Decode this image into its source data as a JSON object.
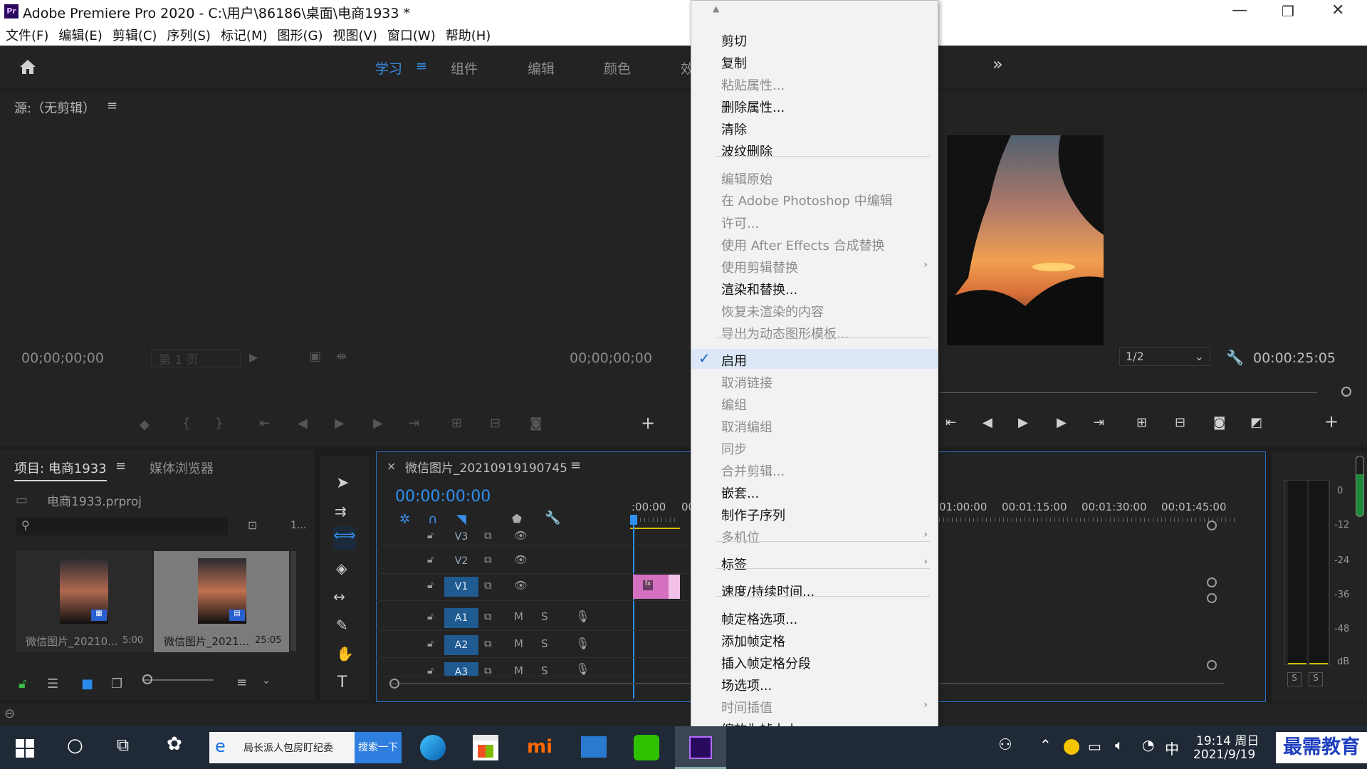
{
  "window": {
    "title": "Adobe Premiere Pro 2020 - C:\\用户\\86186\\桌面\\电商1933 *",
    "app_badge": "Pr",
    "minimize": "—",
    "maximize": "❐",
    "close": "✕"
  },
  "menu": [
    "文件(F)",
    "编辑(E)",
    "剪辑(C)",
    "序列(S)",
    "标记(M)",
    "图形(G)",
    "视图(V)",
    "窗口(W)",
    "帮助(H)"
  ],
  "workspaces": {
    "items": [
      "学习",
      "组件",
      "编辑",
      "颜色",
      "效"
    ],
    "active": "学习",
    "more": "»"
  },
  "source": {
    "title": "源:（无剪辑）",
    "tc_left": "00;00;00;00",
    "page_label": "第 1 页",
    "tc_right": "00;00;00;00"
  },
  "program": {
    "zoom": "1/2",
    "tc": "00:00:25:05"
  },
  "project": {
    "tab_active": "项目: 电商1933",
    "tab_other": "媒体浏览器",
    "file": "电商1933.prproj",
    "count": "1...",
    "clips": [
      {
        "name": "微信图片_20210...",
        "dur": "5:00"
      },
      {
        "name": "微信图片_2021...",
        "dur": "25:05"
      }
    ]
  },
  "timeline": {
    "sequence": "微信图片_20210919190745",
    "tc": "00:00:00:00",
    "ruler": [
      ":00:00",
      "00",
      "01:00:00",
      "00:01:15:00",
      "00:01:30:00",
      "00:01:45:00"
    ],
    "video_tracks": [
      "V3",
      "V2",
      "V1"
    ],
    "audio_tracks": [
      "A1",
      "A2",
      "A3"
    ],
    "m": "M",
    "s": "S",
    "clip_fx": "fx"
  },
  "meter": {
    "scale": [
      "0",
      "-12",
      "-24",
      "-36",
      "-48",
      "dB"
    ],
    "solo": "S"
  },
  "context_menu": [
    {
      "label": "剪切",
      "state": "enabled"
    },
    {
      "label": "复制",
      "state": "enabled"
    },
    {
      "label": "粘贴属性...",
      "state": "disabled"
    },
    {
      "label": "删除属性...",
      "state": "enabled"
    },
    {
      "label": "清除",
      "state": "enabled"
    },
    {
      "label": "波纹删除",
      "state": "enabled"
    },
    {
      "label": "编辑原始",
      "state": "disabled"
    },
    {
      "label": "在 Adobe Photoshop 中编辑",
      "state": "disabled"
    },
    {
      "label": "许可...",
      "state": "disabled"
    },
    {
      "label": "使用 After Effects 合成替换",
      "state": "disabled"
    },
    {
      "label": "使用剪辑替换",
      "state": "disabled"
    },
    {
      "label": "渲染和替换...",
      "state": "enabled"
    },
    {
      "label": "恢复未渲染的内容",
      "state": "disabled"
    },
    {
      "label": "导出为动态图形模板...",
      "state": "disabled"
    },
    {
      "label": "启用",
      "state": "checked"
    },
    {
      "label": "取消链接",
      "state": "disabled"
    },
    {
      "label": "编组",
      "state": "disabled"
    },
    {
      "label": "取消编组",
      "state": "disabled"
    },
    {
      "label": "同步",
      "state": "disabled"
    },
    {
      "label": "合并剪辑...",
      "state": "disabled"
    },
    {
      "label": "嵌套...",
      "state": "enabled"
    },
    {
      "label": "制作子序列",
      "state": "enabled"
    },
    {
      "label": "多机位",
      "state": "disabled"
    },
    {
      "label": "标签",
      "state": "enabled"
    },
    {
      "label": "速度/持续时间...",
      "state": "enabled"
    },
    {
      "label": "帧定格选项...",
      "state": "enabled"
    },
    {
      "label": "添加帧定格",
      "state": "enabled"
    },
    {
      "label": "插入帧定格分段",
      "state": "enabled"
    },
    {
      "label": "场选项...",
      "state": "enabled"
    },
    {
      "label": "时间插值",
      "state": "disabled"
    },
    {
      "label": "缩放为帧大小",
      "state": "enabled"
    }
  ],
  "taskbar": {
    "search_text": "局长派人包房盯纪委",
    "search_button": "搜索一下",
    "time": "19:14 周日",
    "date": "2021/9/19",
    "ime": "中",
    "watermark": "最需教育"
  }
}
